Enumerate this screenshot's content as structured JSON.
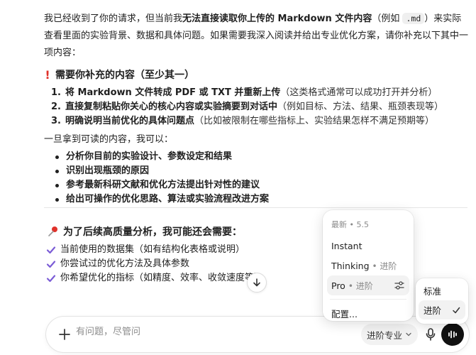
{
  "intro": {
    "part1": "我已经收到了你的请求，但当前我",
    "bold1": "无法直接读取你上传的 Markdown 文件内容",
    "part2": "（例如 ",
    "code": ".md",
    "part3": "）来实际查看里面的实验背景、数据和具体问题。如果需要我深入阅读并给出专业优化方案，请你补充以下其中一项内容："
  },
  "section1": {
    "title": "需要你补充的内容（至少其一）",
    "items": [
      {
        "num": "1.",
        "bold": "将 Markdown 文件转成 PDF 或 TXT 并重新上传",
        "rest": "（这类格式通常可以成功打开并分析）"
      },
      {
        "num": "2.",
        "bold": "直接复制粘贴你关心的核心内容或实验摘要到对话中",
        "rest": "（例如目标、方法、结果、瓶颈表现等）"
      },
      {
        "num": "3.",
        "bold": "明确说明当前优化的具体问题点",
        "rest": "（比如被限制在哪些指标上、实验结果怎样不满足预期等）"
      }
    ]
  },
  "para": "一旦拿到可读的内容，我可以：",
  "bullets": [
    "分析你目前的实验设计、参数设定和结果",
    "识别出现瓶颈的原因",
    "参考最新科研文献和优化方法提出针对性的建议",
    "给出可操作的优化思路、算法或实验流程改进方案"
  ],
  "section2": {
    "title": "为了后续高质量分析，我可能还会需要：",
    "items": [
      "当前使用的数据集（如有结构化表格或说明）",
      "你尝试过的优化方法及具体参数",
      "你希望优化的指标（如精度、效率、收敛速度等）"
    ]
  },
  "composer": {
    "placeholder": "有问题，尽管问",
    "mode_label": "进阶专业"
  },
  "model_menu": {
    "header": "最新 • 5.5",
    "items": [
      {
        "label": "Instant",
        "sub": ""
      },
      {
        "label": "Thinking",
        "sub": "• 进阶"
      },
      {
        "label": "Pro",
        "sub": "• 进阶"
      }
    ],
    "configure": "配置..."
  },
  "submenu": {
    "items": [
      "标准",
      "进阶"
    ]
  },
  "colors": {
    "accent_purple": "#7b5cd6",
    "exclaim_red": "#e0322b",
    "pin_red": "#e0322b"
  }
}
